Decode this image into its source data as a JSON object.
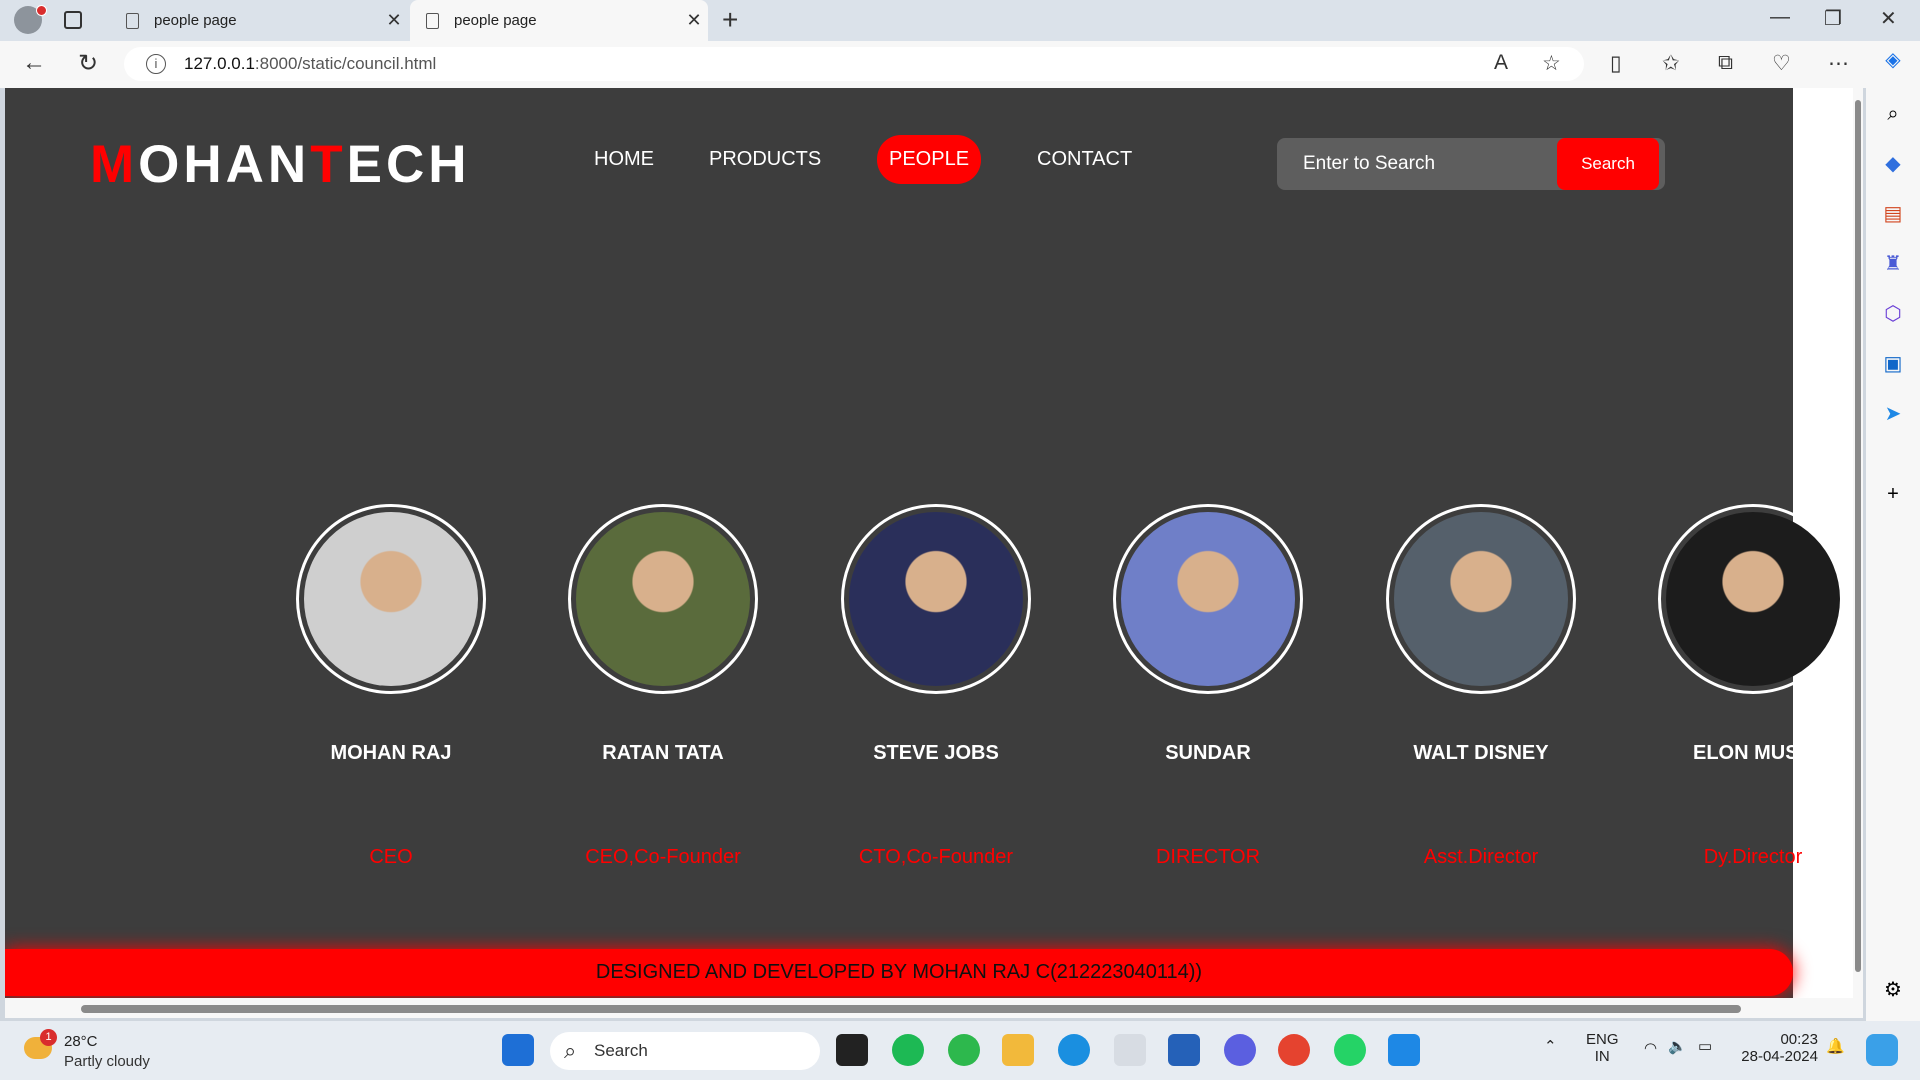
{
  "browser": {
    "tabs": [
      {
        "title": "people page",
        "active": false
      },
      {
        "title": "people page",
        "active": true
      }
    ],
    "url_host": "127.0.0.1",
    "url_path": ":8000/static/council.html"
  },
  "page": {
    "logo": {
      "first_red": "M",
      "part1": "OHAN",
      "second_red": "T",
      "part2": "ECH"
    },
    "nav": [
      {
        "label": "HOME",
        "active": false
      },
      {
        "label": "PRODUCTS",
        "active": false
      },
      {
        "label": "PEOPLE",
        "active": true
      },
      {
        "label": "CONTACT",
        "active": false
      }
    ],
    "search": {
      "placeholder": "Enter to Search",
      "button": "Search"
    },
    "people": [
      {
        "name": "MOHAN RAJ",
        "role": "CEO",
        "photo_color": "#cfcfcf"
      },
      {
        "name": "RATAN TATA",
        "role": "CEO,Co-Founder",
        "photo_color": "#5a6b3c"
      },
      {
        "name": "STEVE JOBS",
        "role": "CTO,Co-Founder",
        "photo_color": "#2a2f5a"
      },
      {
        "name": "SUNDAR",
        "role": "DIRECTOR",
        "photo_color": "#6f7fc8"
      },
      {
        "name": "WALT DISNEY",
        "role": "Asst.Director",
        "photo_color": "#55606b"
      },
      {
        "name": "ELON MUSK",
        "role": "Dy.Director",
        "photo_color": "#1c1c1c"
      }
    ],
    "footer": "DESIGNED AND DEVELOPED BY MOHAN RAJ C(212223040114))"
  },
  "taskbar": {
    "weather": {
      "temp": "28°C",
      "condition": "Partly cloudy",
      "badge": "1"
    },
    "search_label": "Search",
    "lang": "ENG",
    "region": "IN",
    "time": "00:23",
    "date": "28-04-2024"
  }
}
